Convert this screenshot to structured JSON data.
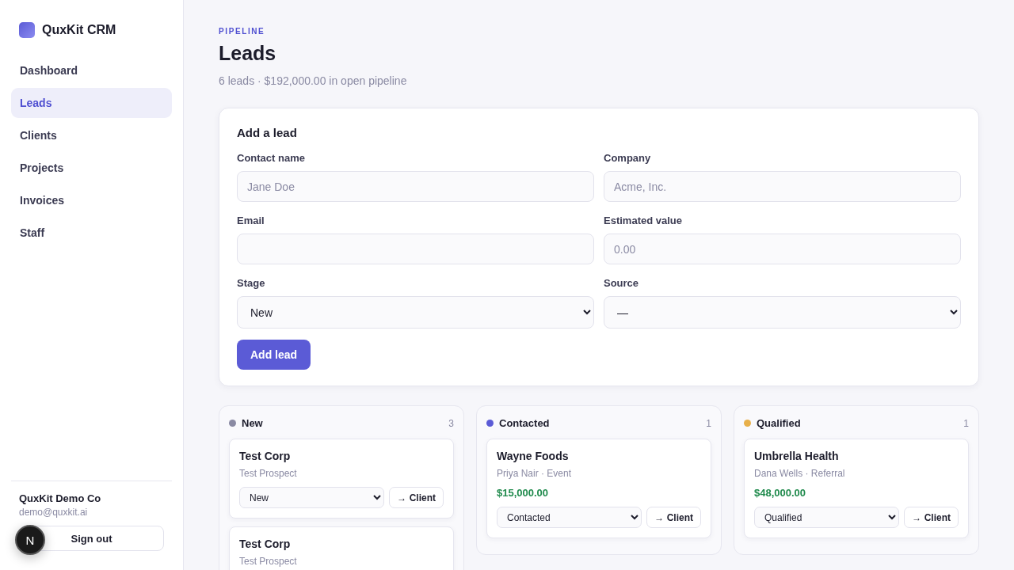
{
  "sidebar": {
    "brand": "QuxKit CRM",
    "items": [
      {
        "label": "Dashboard",
        "selected": false
      },
      {
        "label": "Leads",
        "selected": true
      },
      {
        "label": "Clients",
        "selected": false
      },
      {
        "label": "Projects",
        "selected": false
      },
      {
        "label": "Invoices",
        "selected": false
      },
      {
        "label": "Staff",
        "selected": false
      }
    ],
    "account": {
      "name": "QuxKit Demo Co",
      "email": "demo@quxkit.ai"
    },
    "sign_out": "Sign out"
  },
  "dev_badge": "N",
  "header": {
    "eyebrow": "PIPELINE",
    "title": "Leads",
    "summary": "6 leads · $192,000.00 in open pipeline"
  },
  "form": {
    "title": "Add a lead",
    "fields": [
      {
        "kind": "input",
        "label": "Contact name",
        "placeholder": "Jane Doe"
      },
      {
        "kind": "input",
        "label": "Company",
        "placeholder": "Acme, Inc."
      },
      {
        "kind": "input",
        "label": "Email"
      },
      {
        "kind": "input",
        "label": "Estimated value",
        "placeholder": "0.00"
      },
      {
        "kind": "select",
        "label": "Stage",
        "value": "New"
      },
      {
        "kind": "select",
        "label": "Source",
        "value": "—"
      }
    ],
    "submit": "Add lead"
  },
  "columns": [
    {
      "title": "New",
      "color": "#8a8aa3",
      "count": "3",
      "cards": [
        {
          "company": "Test Corp",
          "meta": "Test Prospect",
          "stage": "New",
          "action": "→ Client"
        },
        {
          "company": "Test Corp",
          "meta": "Test Prospect"
        }
      ]
    },
    {
      "title": "Contacted",
      "color": "#5b5bd6",
      "count": "1",
      "cards": [
        {
          "company": "Wayne Foods",
          "meta": "Priya Nair · Event",
          "value": "$15,000.00",
          "stage": "Contacted",
          "action": "→ Client"
        }
      ]
    },
    {
      "title": "Qualified",
      "color": "#e8b04a",
      "count": "1",
      "cards": [
        {
          "company": "Umbrella Health",
          "meta": "Dana Wells · Referral",
          "value": "$48,000.00",
          "stage": "Qualified",
          "action": "→ Client"
        }
      ]
    }
  ]
}
